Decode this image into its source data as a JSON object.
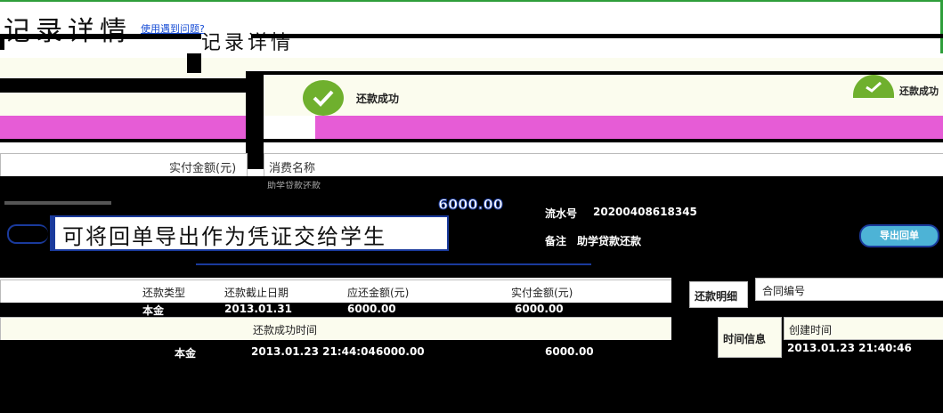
{
  "page": {
    "title": "记录详情",
    "help_link": "使用遇到问题?",
    "ghost_title": "记录详情"
  },
  "status": {
    "left_text": "还款成功",
    "right_text": "还款成功"
  },
  "upper_table": {
    "left_header": "实付金额(元)",
    "right_header": "消费名称",
    "sub_label": "助学贷款还款",
    "amount": "6000.00",
    "serial_label": "流水号",
    "serial_value": "20200408618345",
    "remark_label": "备注",
    "remark_value": "助学贷款还款",
    "receipt_button": "导出回单"
  },
  "callout": {
    "text": "可将回单导出作为凭证交给学生"
  },
  "repay_table": {
    "headers": [
      "还款类型",
      "还款截止日期",
      "应还金额(元)",
      "实付金额(元)"
    ],
    "row": [
      "本金",
      "2013.01.31",
      "6000.00",
      "6000.00"
    ],
    "success_time_header": "还款成功时间",
    "row2": [
      "本金",
      "2013.01.23 21:44:04",
      "6000.00",
      "6000.00"
    ]
  },
  "side": {
    "repay_info_label": "还款明细",
    "contract_label": "合同编号",
    "time_info_label": "时间信息",
    "created_label": "创建时间",
    "created_value": "2013.01.23 21:40:46"
  },
  "colors": {
    "accent_green": "#6fb02e",
    "banner_pink": "#e65cd6",
    "link_blue": "#1a4fd6",
    "highlight_blue": "#1a3a9c"
  }
}
